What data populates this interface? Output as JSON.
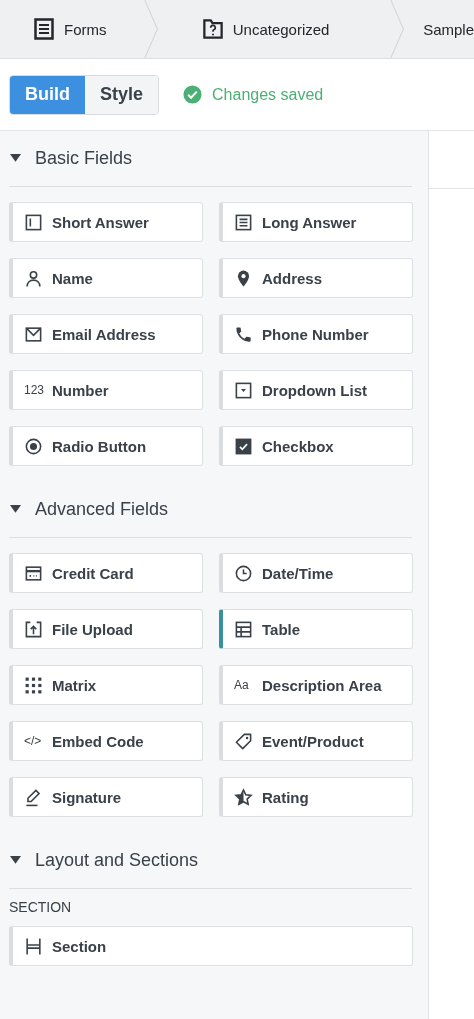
{
  "breadcrumbs": [
    {
      "label": "Forms"
    },
    {
      "label": "Uncategorized"
    },
    {
      "label": "Sample"
    }
  ],
  "mode_tabs": [
    {
      "label": "Build",
      "selected": true
    },
    {
      "label": "Style",
      "selected": false
    }
  ],
  "save_status": "Changes saved",
  "groups": [
    {
      "title": "Basic Fields",
      "expanded": true,
      "items": [
        {
          "label": "Short Answer",
          "highlighted": false
        },
        {
          "label": "Long Answer",
          "highlighted": false
        },
        {
          "label": "Name",
          "highlighted": false
        },
        {
          "label": "Address",
          "highlighted": false
        },
        {
          "label": "Email Address",
          "highlighted": false
        },
        {
          "label": "Phone Number",
          "highlighted": false
        },
        {
          "label": "Number",
          "glyph": "123",
          "highlighted": false
        },
        {
          "label": "Dropdown List",
          "highlighted": false
        },
        {
          "label": "Radio Button",
          "highlighted": false
        },
        {
          "label": "Checkbox",
          "highlighted": false
        }
      ]
    },
    {
      "title": "Advanced Fields",
      "expanded": true,
      "items": [
        {
          "label": "Credit Card",
          "highlighted": false
        },
        {
          "label": "Date/Time",
          "highlighted": false
        },
        {
          "label": "File Upload",
          "highlighted": false
        },
        {
          "label": "Table",
          "highlighted": true
        },
        {
          "label": "Matrix",
          "highlighted": false
        },
        {
          "label": "Description Area",
          "glyph": "Aa",
          "highlighted": false
        },
        {
          "label": "Embed Code",
          "glyph": "</>",
          "highlighted": false
        },
        {
          "label": "Event/Product",
          "highlighted": false
        },
        {
          "label": "Signature",
          "highlighted": false
        },
        {
          "label": "Rating",
          "highlighted": false
        }
      ]
    },
    {
      "title": "Layout and Sections",
      "expanded": true,
      "subheading": "SECTION",
      "items": [
        {
          "label": "Section",
          "highlighted": false
        }
      ]
    }
  ]
}
